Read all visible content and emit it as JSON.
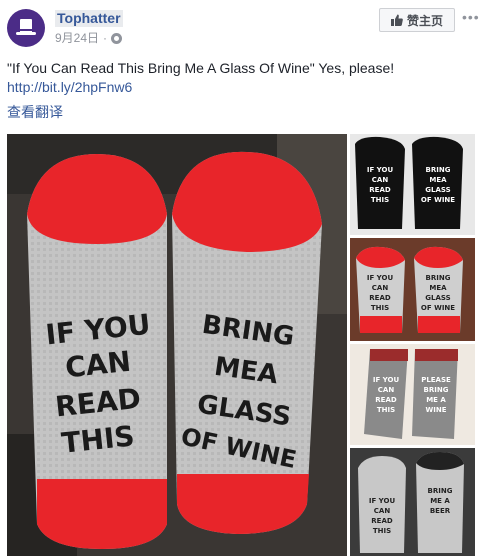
{
  "post": {
    "page_name": "Tophatter",
    "date": "9月24日",
    "separator": "·",
    "text": "\"If You Can Read This Bring Me A Glass Of Wine\" Yes, please!",
    "link": "http://bit.ly/2hpFnw6",
    "translate_label": "查看翻译"
  },
  "header": {
    "like_page_label": "赞主页",
    "more_label": "•••"
  },
  "icons": {
    "avatar": "top-hat-logo",
    "privacy": "globe-icon",
    "like": "thumbs-up-icon",
    "more": "ellipsis-icon"
  },
  "photos": {
    "main": {
      "left_sock": [
        "IF YOU",
        "CAN",
        "READ",
        "THIS"
      ],
      "right_sock": [
        "BRING",
        "MEA",
        "GLASS",
        "OF WINE"
      ]
    },
    "thumbs": [
      {
        "left": [
          "IF YOU",
          "CAN",
          "READ",
          "THIS"
        ],
        "right": [
          "BRING",
          "MEA",
          "GLASS",
          "OF WINE"
        ]
      },
      {
        "left": [
          "IF YOU",
          "CAN",
          "READ",
          "THIS"
        ],
        "right": [
          "BRING",
          "MEA",
          "GLASS",
          "OF WINE"
        ]
      },
      {
        "left": [
          "IF YOU",
          "CAN",
          "READ",
          "THIS"
        ],
        "right": [
          "PLEASE",
          "BRING",
          "ME A",
          "WINE"
        ]
      },
      {
        "left": [
          "IF YOU",
          "CAN",
          "READ",
          "THIS"
        ],
        "right": [
          "BRING",
          "ME A",
          "BEER"
        ]
      }
    ]
  },
  "colors": {
    "link": "#365899",
    "brand_avatar": "#4b2c87",
    "sock_red": "#e8252a",
    "sock_gray": "#c8c8c8"
  }
}
